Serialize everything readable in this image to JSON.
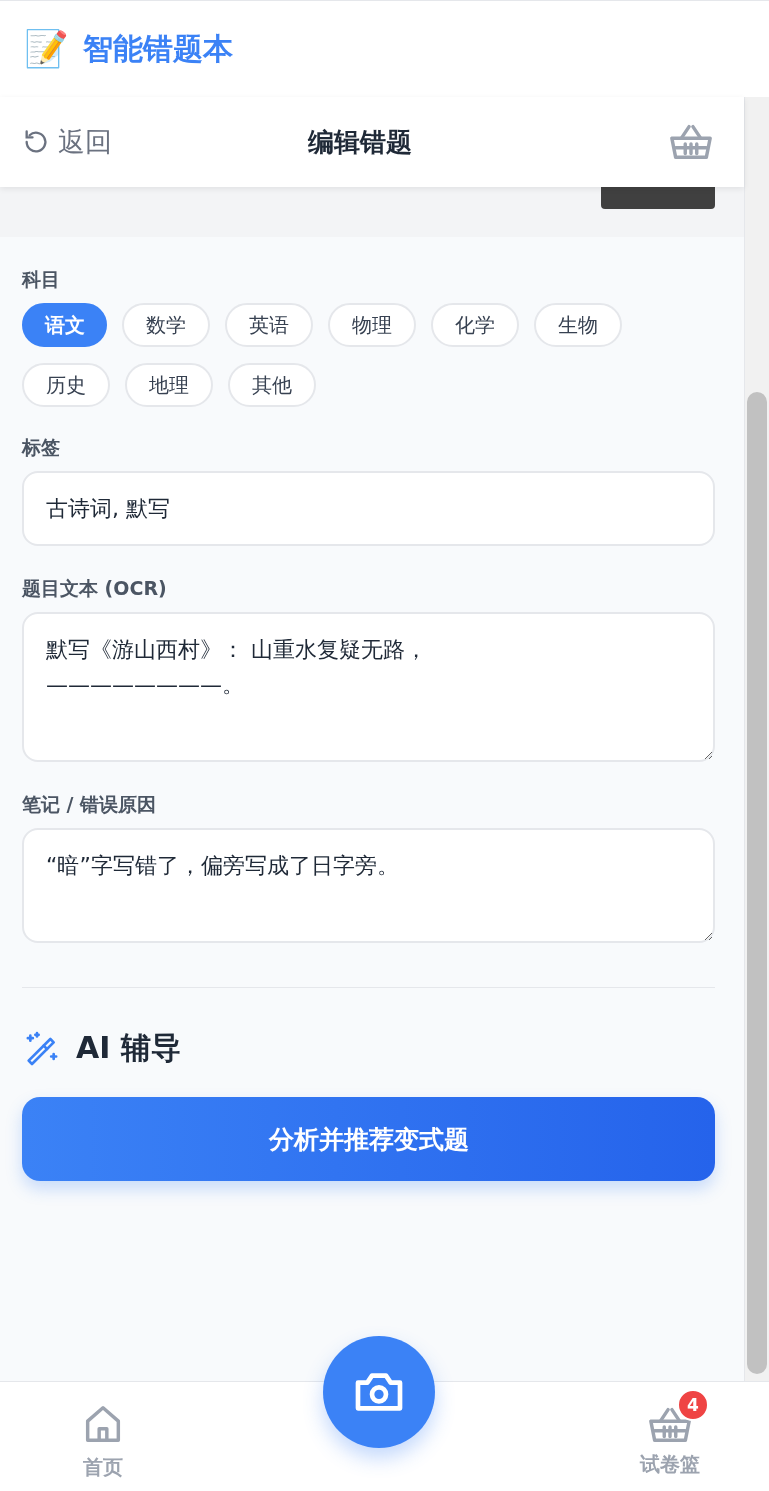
{
  "app_header": {
    "emoji": "📝",
    "title": "智能错题本"
  },
  "page_header": {
    "back": "返回",
    "title": "编辑错题"
  },
  "subject": {
    "label": "科目",
    "options": [
      {
        "label": "语文",
        "selected": true
      },
      {
        "label": "数学",
        "selected": false
      },
      {
        "label": "英语",
        "selected": false
      },
      {
        "label": "物理",
        "selected": false
      },
      {
        "label": "化学",
        "selected": false
      },
      {
        "label": "生物",
        "selected": false
      },
      {
        "label": "历史",
        "selected": false
      },
      {
        "label": "地理",
        "selected": false
      },
      {
        "label": "其他",
        "selected": false
      }
    ]
  },
  "tags": {
    "label": "标签",
    "value": "古诗词, 默写"
  },
  "question_text": {
    "label": "题目文本 (OCR)",
    "value": "默写《游山西村》： 山重水复疑无路，\n————————。"
  },
  "notes": {
    "label": "笔记 / 错误原因",
    "value": "“暗”字写错了，偏旁写成了日字旁。"
  },
  "ai": {
    "title": "AI 辅导",
    "button": "分析并推荐变式题"
  },
  "bottom_nav": [
    {
      "kind": "home",
      "label": "首页"
    },
    {
      "kind": "camera"
    },
    {
      "kind": "basket",
      "label": "试卷篮",
      "badge": "4"
    }
  ]
}
